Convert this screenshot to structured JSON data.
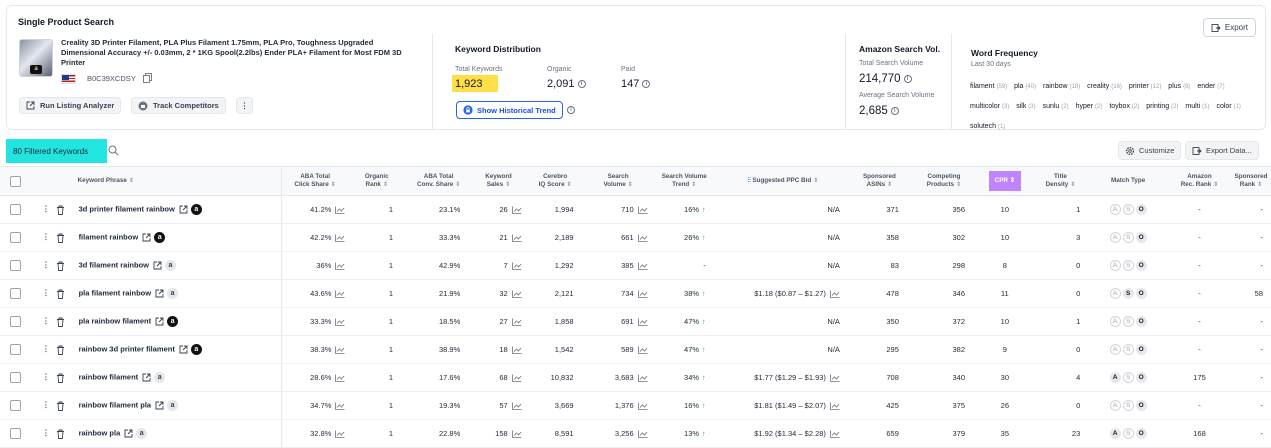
{
  "header": {
    "title": "Single Product Search",
    "export_label": "Export"
  },
  "product": {
    "title": "Creality 3D Printer Filament, PLA Plus Filament 1.75mm, PLA Pro, Toughness Upgraded Dimensional Accuracy +/- 0.03mm, 2 * 1KG Spool(2.2lbs) Ender PLA+ Filament for Most FDM 3D Printer",
    "asin": "B0C39XCDSY",
    "buttons": {
      "run": "Run Listing Analyzer",
      "track": "Track Competitors",
      "more": "⋮"
    }
  },
  "keyword_distribution": {
    "title": "Keyword Distribution",
    "total_label": "Total Keywords",
    "total_value": "1,923",
    "organic_label": "Organic",
    "organic_value": "2,091",
    "paid_label": "Paid",
    "paid_value": "147",
    "historical_button": "Show Historical Trend"
  },
  "search_volume": {
    "title": "Amazon Search Vol.",
    "total_label": "Total Search Volume",
    "total_value": "214,770",
    "avg_label": "Average Search Volume",
    "avg_value": "2,685"
  },
  "word_frequency": {
    "title": "Word Frequency",
    "subtitle": "Last 30 days",
    "words": [
      {
        "w": "filament",
        "c": "(59)"
      },
      {
        "w": "pla",
        "c": "(40)"
      },
      {
        "w": "rainbow",
        "c": "(18)"
      },
      {
        "w": "creality",
        "c": "(16)"
      },
      {
        "w": "printer",
        "c": "(12)"
      },
      {
        "w": "plus",
        "c": "(8)"
      },
      {
        "w": "ender",
        "c": "(7)"
      },
      {
        "w": "multicolor",
        "c": "(3)"
      },
      {
        "w": "silk",
        "c": "(3)"
      },
      {
        "w": "sunlu",
        "c": "(2)"
      },
      {
        "w": "hyper",
        "c": "(2)"
      },
      {
        "w": "toybox",
        "c": "(2)"
      },
      {
        "w": "printing",
        "c": "(2)"
      },
      {
        "w": "multi",
        "c": "(1)"
      },
      {
        "w": "color",
        "c": "(1)"
      },
      {
        "w": "solutech",
        "c": "(1)"
      }
    ]
  },
  "toolbar": {
    "filtered_label": "80 Filtered Keywords",
    "customize_label": "Customize",
    "export_data_label": "Export Data..."
  },
  "table": {
    "headers": {
      "phrase": "Keyword Phrase",
      "aba_click": [
        "ABA Total",
        "Click Share"
      ],
      "organic": [
        "Organic",
        "Rank"
      ],
      "aba_conv": [
        "ABA Total",
        "Conv. Share"
      ],
      "kw_sales": [
        "Keyword",
        "Sales"
      ],
      "cerebro": [
        "Cerebro",
        "IQ Score"
      ],
      "search_vol": [
        "Search",
        "Volume"
      ],
      "sv_trend": [
        "Search Volume",
        "Trend"
      ],
      "ppc": "Suggested PPC Bid",
      "sponsored_asins": [
        "Sponsored",
        "ASINs"
      ],
      "competing": [
        "Competing",
        "Products"
      ],
      "cpr": "CPR",
      "title_density": [
        "Title",
        "Density"
      ],
      "match_type": "Match Type",
      "amazon_rank": [
        "Amazon",
        "Rec. Rank"
      ],
      "sponsored_rank": [
        "Sponsored",
        "Rank"
      ]
    },
    "rows": [
      {
        "kw": "3d printer filament rainbow",
        "amz": "dark",
        "click": "41.2%",
        "org": "1",
        "conv": "23.1%",
        "sales": "26",
        "iq": "1,994",
        "sv": "710",
        "trend": "16%",
        "up": true,
        "ppc": "N/A",
        "ppc_chart": false,
        "sasins": "371",
        "comp": "356",
        "cpr": "10",
        "td": "1",
        "mt": [
          false,
          false,
          true
        ],
        "arr": "-",
        "sr": "-"
      },
      {
        "kw": "filament rainbow",
        "amz": "dark",
        "click": "42.2%",
        "org": "1",
        "conv": "33.3%",
        "sales": "21",
        "iq": "2,189",
        "sv": "661",
        "trend": "26%",
        "up": true,
        "ppc": "N/A",
        "ppc_chart": false,
        "sasins": "358",
        "comp": "302",
        "cpr": "10",
        "td": "3",
        "mt": [
          false,
          false,
          true
        ],
        "arr": "-",
        "sr": "-"
      },
      {
        "kw": "3d filament rainbow",
        "amz": "light",
        "click": "36%",
        "org": "1",
        "conv": "42.9%",
        "sales": "7",
        "iq": "1,292",
        "sv": "385",
        "trend": "-",
        "up": false,
        "ppc": "N/A",
        "ppc_chart": false,
        "sasins": "83",
        "comp": "298",
        "cpr": "8",
        "td": "0",
        "mt": [
          false,
          false,
          true
        ],
        "arr": "-",
        "sr": "-"
      },
      {
        "kw": "pla filament rainbow",
        "amz": "light",
        "click": "43.6%",
        "org": "1",
        "conv": "21.9%",
        "sales": "32",
        "iq": "2,121",
        "sv": "734",
        "trend": "38%",
        "up": true,
        "ppc": "$1.18 ($0.87 – $1.27)",
        "ppc_chart": true,
        "sasins": "478",
        "comp": "346",
        "cpr": "11",
        "td": "0",
        "mt": [
          false,
          true,
          true
        ],
        "arr": "-",
        "sr": "58"
      },
      {
        "kw": "pla rainbow filament",
        "amz": "dark",
        "click": "33.3%",
        "org": "1",
        "conv": "18.5%",
        "sales": "27",
        "iq": "1,858",
        "sv": "691",
        "trend": "47%",
        "up": true,
        "ppc": "N/A",
        "ppc_chart": false,
        "sasins": "350",
        "comp": "372",
        "cpr": "10",
        "td": "1",
        "mt": [
          false,
          false,
          true
        ],
        "arr": "-",
        "sr": "-"
      },
      {
        "kw": "rainbow 3d printer filament",
        "amz": "dark",
        "click": "38.3%",
        "org": "1",
        "conv": "38.9%",
        "sales": "18",
        "iq": "1,542",
        "sv": "589",
        "trend": "47%",
        "up": true,
        "ppc": "N/A",
        "ppc_chart": false,
        "sasins": "295",
        "comp": "382",
        "cpr": "9",
        "td": "0",
        "mt": [
          false,
          false,
          true
        ],
        "arr": "-",
        "sr": "-"
      },
      {
        "kw": "rainbow filament",
        "amz": "light",
        "click": "28.6%",
        "org": "1",
        "conv": "17.6%",
        "sales": "68",
        "iq": "10,832",
        "sv": "3,683",
        "trend": "34%",
        "up": true,
        "ppc": "$1.77 ($1.29 – $1.93)",
        "ppc_chart": true,
        "sasins": "708",
        "comp": "340",
        "cpr": "30",
        "td": "4",
        "mt": [
          true,
          false,
          true
        ],
        "arr": "175",
        "sr": "-"
      },
      {
        "kw": "rainbow filament pla",
        "amz": "light",
        "click": "34.7%",
        "org": "1",
        "conv": "19.3%",
        "sales": "57",
        "iq": "3,669",
        "sv": "1,376",
        "trend": "16%",
        "up": true,
        "ppc": "$1.81 ($1.49 – $2.07)",
        "ppc_chart": true,
        "sasins": "425",
        "comp": "375",
        "cpr": "26",
        "td": "0",
        "mt": [
          false,
          false,
          true
        ],
        "arr": "-",
        "sr": "-"
      },
      {
        "kw": "rainbow pla",
        "amz": "light",
        "click": "32.8%",
        "org": "1",
        "conv": "22.8%",
        "sales": "158",
        "iq": "8,591",
        "sv": "3,256",
        "trend": "13%",
        "up": true,
        "ppc": "$1.92 ($1.34 – $2.28)",
        "ppc_chart": true,
        "sasins": "659",
        "comp": "379",
        "cpr": "35",
        "td": "23",
        "mt": [
          true,
          false,
          true
        ],
        "arr": "168",
        "sr": "-"
      }
    ]
  }
}
